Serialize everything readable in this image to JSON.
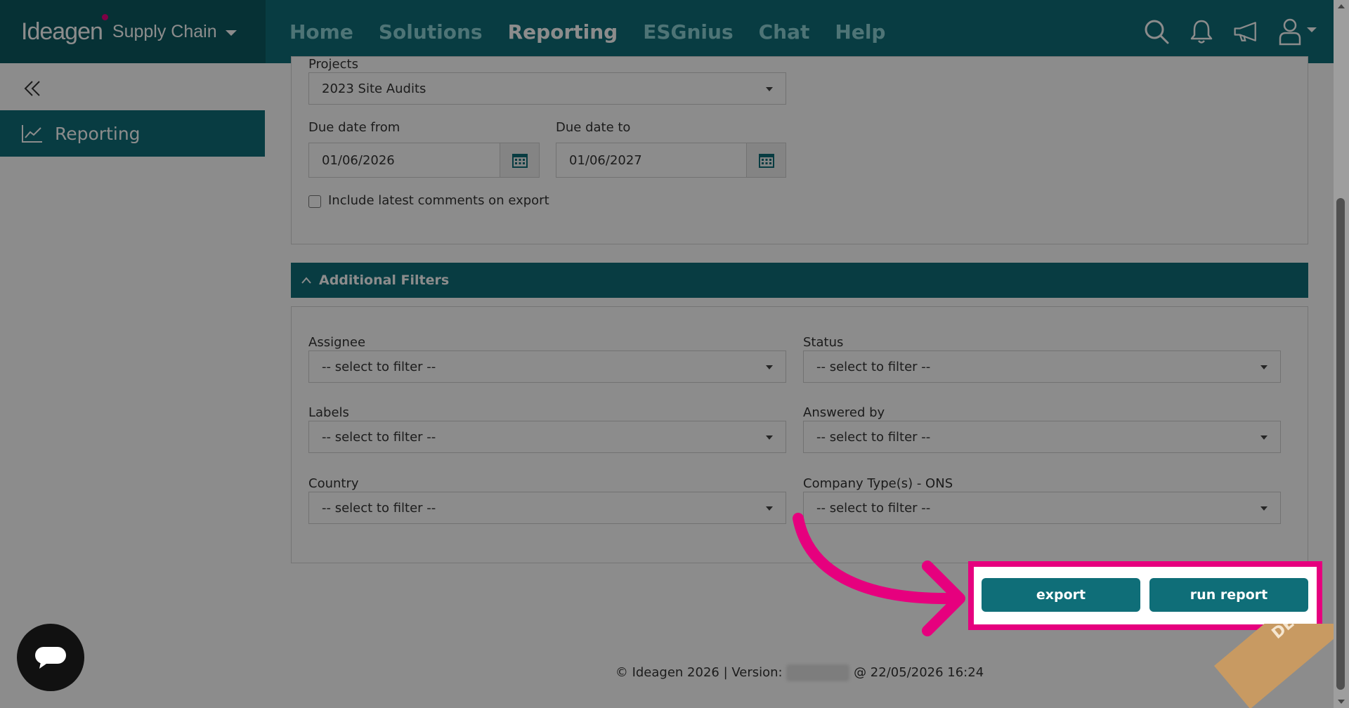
{
  "brand": {
    "logo_text": "Ideagen",
    "product": "Supply Chain"
  },
  "nav": {
    "items": [
      {
        "label": "Home",
        "active": false
      },
      {
        "label": "Solutions",
        "active": false
      },
      {
        "label": "Reporting",
        "active": true
      },
      {
        "label": "ESGnius",
        "active": false
      },
      {
        "label": "Chat",
        "active": false
      },
      {
        "label": "Help",
        "active": false
      }
    ]
  },
  "sidebar": {
    "items": [
      {
        "label": "Reporting"
      }
    ]
  },
  "report": {
    "projects_label": "Projects",
    "projects_value": "2023 Site Audits",
    "due_from_label": "Due date from",
    "due_from_value": "01/06/2026",
    "due_to_label": "Due date to",
    "due_to_value": "01/06/2027",
    "include_comments_label": "Include latest comments on export"
  },
  "filters": {
    "title": "Additional Filters",
    "placeholder": "-- select to filter --",
    "fields": [
      {
        "label": "Assignee"
      },
      {
        "label": "Status"
      },
      {
        "label": "Labels"
      },
      {
        "label": "Answered by"
      },
      {
        "label": "Country"
      },
      {
        "label": "Company Type(s) - ONS"
      }
    ]
  },
  "actions": {
    "export_label": "export",
    "run_report_label": "run report"
  },
  "footer": {
    "prefix": "© Ideagen 2026 | Version:",
    "suffix": "@ 22/05/2026 16:24"
  },
  "ribbon": {
    "text": "DEMO"
  },
  "colors": {
    "primary": "#0f6e78",
    "highlight": "#e6007e",
    "ribbon": "#c89a62"
  }
}
